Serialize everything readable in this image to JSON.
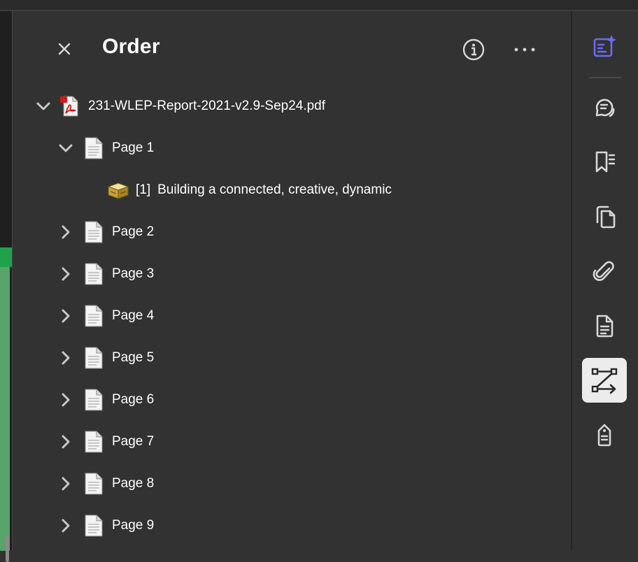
{
  "panel": {
    "title": "Order",
    "close_icon": "close-icon",
    "info_icon": "info-icon",
    "more_icon": "more-options-icon"
  },
  "tree": {
    "file": {
      "name": "231-WLEP-Report-2021-v2.9-Sep24.pdf",
      "icon": "pdf-file-icon",
      "expanded": true
    },
    "pages": [
      {
        "label": "Page 1",
        "expanded": true,
        "children": [
          {
            "number": "[1]",
            "label": "Building a connected, creative, dynamic",
            "icon": "content-container-icon"
          }
        ]
      },
      {
        "label": "Page 2",
        "expanded": false
      },
      {
        "label": "Page 3",
        "expanded": false
      },
      {
        "label": "Page 4",
        "expanded": false
      },
      {
        "label": "Page 5",
        "expanded": false
      },
      {
        "label": "Page 6",
        "expanded": false
      },
      {
        "label": "Page 7",
        "expanded": false
      },
      {
        "label": "Page 8",
        "expanded": false
      },
      {
        "label": "Page 9",
        "expanded": false
      }
    ]
  },
  "toolbar": {
    "items": [
      {
        "name": "ai-assistant-icon",
        "active": false,
        "accent": "#6b6bf5"
      },
      {
        "name": "comment-icon",
        "active": false
      },
      {
        "name": "bookmarks-icon",
        "active": false
      },
      {
        "name": "page-thumbnails-icon",
        "active": false
      },
      {
        "name": "attachments-icon",
        "active": false
      },
      {
        "name": "document-properties-icon",
        "active": false
      },
      {
        "name": "reading-order-icon",
        "active": true
      },
      {
        "name": "tags-icon",
        "active": false
      }
    ]
  },
  "colors": {
    "background": "#323232",
    "text": "#ffffff",
    "accent": "#6b6bf5",
    "active_tool_bg": "#ececec"
  }
}
